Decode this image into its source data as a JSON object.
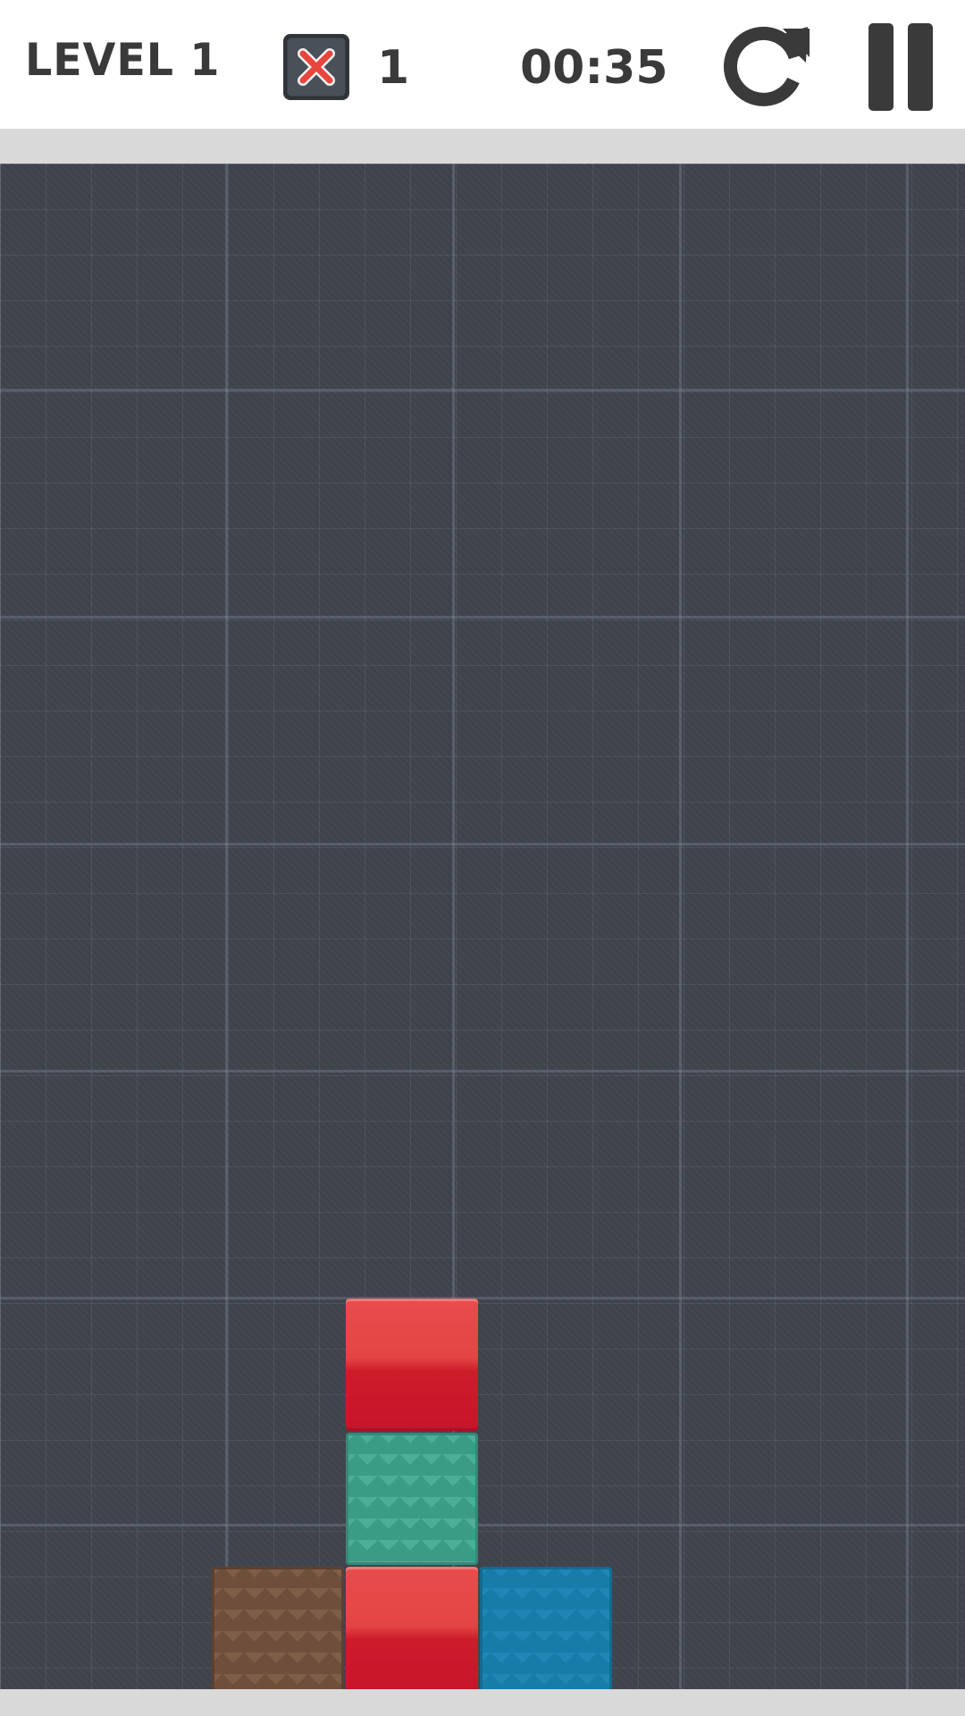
{
  "hud": {
    "level_label": "LEVEL 1",
    "bombs_count": "1",
    "timer": "00:35",
    "bomb_icon": "x-bomb-icon",
    "restart_icon": "restart-icon",
    "pause_icon": "pause-icon"
  },
  "colors": {
    "text": "#3a3a3a",
    "board": "#3f434c",
    "red": "#e44444",
    "teal": "#3b9c86",
    "brown": "#6e4f3b",
    "blue": "#177ca8"
  },
  "board": {
    "blocks": [
      {
        "color": "red",
        "col": 2,
        "row": 2
      },
      {
        "color": "teal",
        "col": 2,
        "row": 1
      },
      {
        "color": "brown",
        "col": 1,
        "row": 0
      },
      {
        "color": "red",
        "col": 2,
        "row": 0
      },
      {
        "color": "blue",
        "col": 3,
        "row": 0
      }
    ]
  }
}
